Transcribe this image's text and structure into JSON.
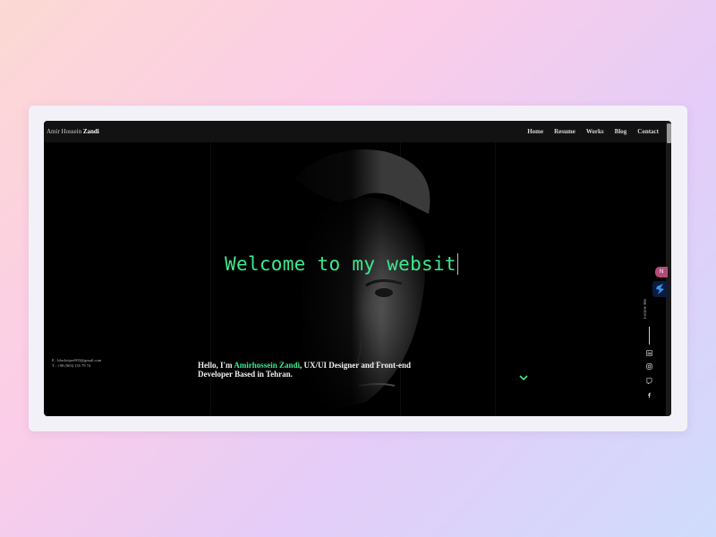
{
  "header": {
    "brand_first": "Amir Hossein",
    "brand_last": "Zandi",
    "nav": [
      "Home",
      "Resume",
      "Works",
      "Blog",
      "Contact"
    ]
  },
  "hero": {
    "welcome_text": "Welcome to my websit",
    "intro_prefix": "Hello, I'm ",
    "intro_name": "Amirhossein Zandi",
    "intro_suffix": ", UX/UI Designer and Front-end Developer Based in Tehran."
  },
  "contact": {
    "email": "E : blackviper903@gmail.com",
    "phone": "T : +98 (903) 155 79 74"
  },
  "social": {
    "follow_label": "Follow Me",
    "icons": [
      "linkedin-icon",
      "instagram-icon",
      "twitch-icon",
      "facebook-icon"
    ]
  },
  "colors": {
    "accent": "#3ee88e",
    "background": "#000000",
    "topbar": "#121212"
  },
  "widgets": {
    "badge_label": "N"
  }
}
